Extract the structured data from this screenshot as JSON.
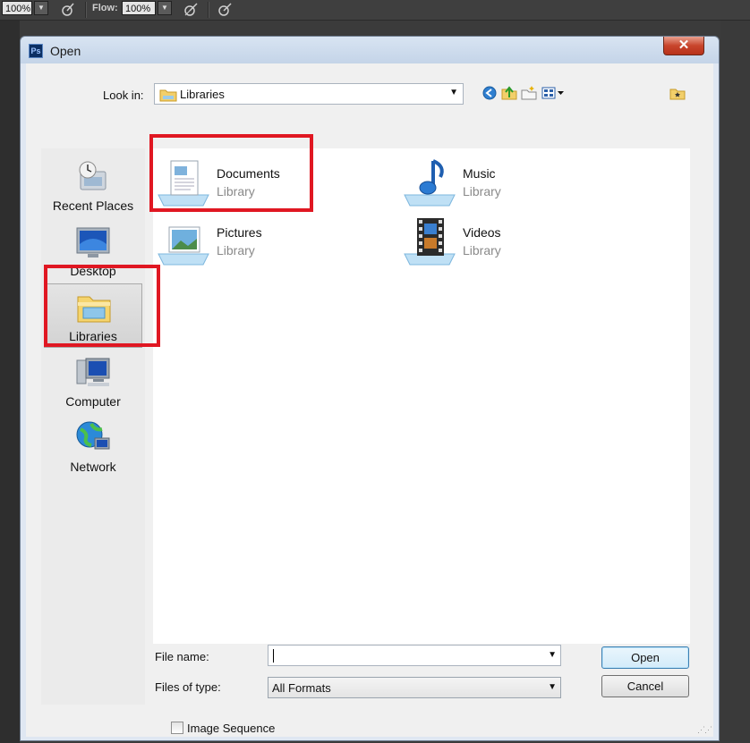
{
  "options_bar": {
    "zoom_value": "100%",
    "flow_label": "Flow:",
    "flow_value": "100%",
    "icons": [
      "airbrush-icon",
      "airbrush-pressure-icon",
      "tablet-pressure-icon"
    ]
  },
  "dialog": {
    "title": "Open",
    "app_icon": "Ps",
    "close_glyph": "✕"
  },
  "look_in": {
    "label": "Look in:",
    "value": "Libraries",
    "nav_icons": [
      "back-icon",
      "up-folder-icon",
      "new-folder-icon",
      "view-menu-icon",
      "favorites-icon"
    ]
  },
  "places": [
    {
      "label": "Recent Places",
      "icon": "recent-places-icon"
    },
    {
      "label": "Desktop",
      "icon": "desktop-icon"
    },
    {
      "label": "Libraries",
      "icon": "libraries-icon",
      "selected": true
    },
    {
      "label": "Computer",
      "icon": "computer-icon"
    },
    {
      "label": "Network",
      "icon": "network-icon"
    }
  ],
  "files": [
    {
      "name": "Documents",
      "type": "Library",
      "icon": "documents-library-icon"
    },
    {
      "name": "Music",
      "type": "Library",
      "icon": "music-library-icon"
    },
    {
      "name": "Pictures",
      "type": "Library",
      "icon": "pictures-library-icon"
    },
    {
      "name": "Videos",
      "type": "Library",
      "icon": "videos-library-icon"
    }
  ],
  "file_name": {
    "label": "File name:",
    "value": ""
  },
  "file_type": {
    "label": "Files of type:",
    "value": "All Formats"
  },
  "buttons": {
    "open": "Open",
    "cancel": "Cancel"
  },
  "image_sequence": {
    "label": "Image Sequence",
    "checked": false
  },
  "highlight_color": "#e01722"
}
